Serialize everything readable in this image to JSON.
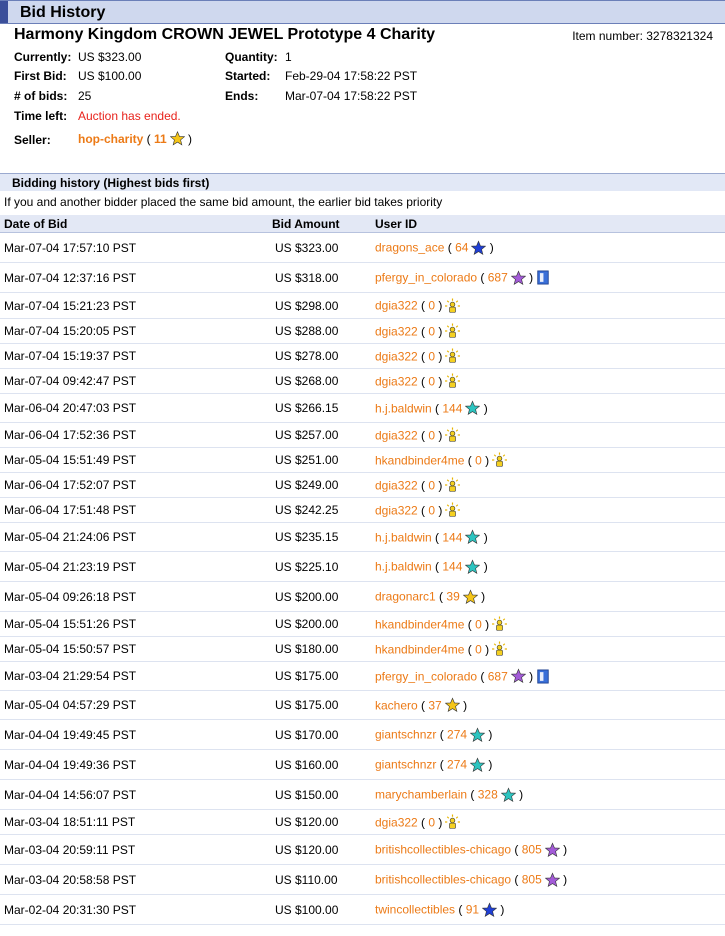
{
  "header": {
    "title": "Bid History"
  },
  "item": {
    "title": "Harmony Kingdom CROWN JEWEL Prototype 4 Charity",
    "number_label": "Item number:",
    "number": "3278321324"
  },
  "summary": {
    "currently_label": "Currently:",
    "currently": "US $323.00",
    "first_bid_label": "First Bid:",
    "first_bid": "US $100.00",
    "num_bids_label": "# of bids:",
    "num_bids": "25",
    "time_left_label": "Time left:",
    "time_left": "Auction has ended.",
    "quantity_label": "Quantity:",
    "quantity": "1",
    "started_label": "Started:",
    "started": "Feb-29-04 17:58:22 PST",
    "ends_label": "Ends:",
    "ends": "Mar-07-04 17:58:22 PST",
    "seller_label": "Seller:",
    "seller": "hop-charity",
    "seller_feedback": "11",
    "seller_star": "#f5c518"
  },
  "history": {
    "section_title": "Bidding history (Highest bids first)",
    "note": "If you and another bidder placed the same bid amount, the earlier bid takes priority",
    "columns": [
      "Date of Bid",
      "Bid Amount",
      "User ID"
    ],
    "rows": [
      {
        "date": "Mar-07-04 17:57:10 PST",
        "amount": "US $323.00",
        "user": "dragons_ace",
        "feedback": "64",
        "icon": "blue-star"
      },
      {
        "date": "Mar-07-04 12:37:16 PST",
        "amount": "US $318.00",
        "user": "pfergy_in_colorado",
        "feedback": "687",
        "icon": "purple-star",
        "me": true
      },
      {
        "date": "Mar-07-04 15:21:23 PST",
        "amount": "US $298.00",
        "user": "dgia322",
        "feedback": "0",
        "icon": "new-user"
      },
      {
        "date": "Mar-07-04 15:20:05 PST",
        "amount": "US $288.00",
        "user": "dgia322",
        "feedback": "0",
        "icon": "new-user"
      },
      {
        "date": "Mar-07-04 15:19:37 PST",
        "amount": "US $278.00",
        "user": "dgia322",
        "feedback": "0",
        "icon": "new-user"
      },
      {
        "date": "Mar-07-04 09:42:47 PST",
        "amount": "US $268.00",
        "user": "dgia322",
        "feedback": "0",
        "icon": "new-user"
      },
      {
        "date": "Mar-06-04 20:47:03 PST",
        "amount": "US $266.15",
        "user": "h.j.baldwin",
        "feedback": "144",
        "icon": "turquoise-star"
      },
      {
        "date": "Mar-06-04 17:52:36 PST",
        "amount": "US $257.00",
        "user": "dgia322",
        "feedback": "0",
        "icon": "new-user"
      },
      {
        "date": "Mar-05-04 15:51:49 PST",
        "amount": "US $251.00",
        "user": "hkandbinder4me",
        "feedback": "0",
        "icon": "new-user"
      },
      {
        "date": "Mar-06-04 17:52:07 PST",
        "amount": "US $249.00",
        "user": "dgia322",
        "feedback": "0",
        "icon": "new-user"
      },
      {
        "date": "Mar-06-04 17:51:48 PST",
        "amount": "US $242.25",
        "user": "dgia322",
        "feedback": "0",
        "icon": "new-user"
      },
      {
        "date": "Mar-05-04 21:24:06 PST",
        "amount": "US $235.15",
        "user": "h.j.baldwin",
        "feedback": "144",
        "icon": "turquoise-star"
      },
      {
        "date": "Mar-05-04 21:23:19 PST",
        "amount": "US $225.10",
        "user": "h.j.baldwin",
        "feedback": "144",
        "icon": "turquoise-star"
      },
      {
        "date": "Mar-05-04 09:26:18 PST",
        "amount": "US $200.00",
        "user": "dragonarc1",
        "feedback": "39",
        "icon": "yellow-star"
      },
      {
        "date": "Mar-05-04 15:51:26 PST",
        "amount": "US $200.00",
        "user": "hkandbinder4me",
        "feedback": "0",
        "icon": "new-user"
      },
      {
        "date": "Mar-05-04 15:50:57 PST",
        "amount": "US $180.00",
        "user": "hkandbinder4me",
        "feedback": "0",
        "icon": "new-user"
      },
      {
        "date": "Mar-03-04 21:29:54 PST",
        "amount": "US $175.00",
        "user": "pfergy_in_colorado",
        "feedback": "687",
        "icon": "purple-star",
        "me": true
      },
      {
        "date": "Mar-05-04 04:57:29 PST",
        "amount": "US $175.00",
        "user": "kachero",
        "feedback": "37",
        "icon": "yellow-star"
      },
      {
        "date": "Mar-04-04 19:49:45 PST",
        "amount": "US $170.00",
        "user": "giantschnzr",
        "feedback": "274",
        "icon": "turquoise-star"
      },
      {
        "date": "Mar-04-04 19:49:36 PST",
        "amount": "US $160.00",
        "user": "giantschnzr",
        "feedback": "274",
        "icon": "turquoise-star"
      },
      {
        "date": "Mar-04-04 14:56:07 PST",
        "amount": "US $150.00",
        "user": "marychamberlain",
        "feedback": "328",
        "icon": "turquoise-star"
      },
      {
        "date": "Mar-03-04 18:51:11 PST",
        "amount": "US $120.00",
        "user": "dgia322",
        "feedback": "0",
        "icon": "new-user"
      },
      {
        "date": "Mar-03-04 20:59:11 PST",
        "amount": "US $120.00",
        "user": "britishcollectibles-chicago",
        "feedback": "805",
        "icon": "purple-star"
      },
      {
        "date": "Mar-03-04 20:58:58 PST",
        "amount": "US $110.00",
        "user": "britishcollectibles-chicago",
        "feedback": "805",
        "icon": "purple-star"
      },
      {
        "date": "Mar-02-04 20:31:30 PST",
        "amount": "US $100.00",
        "user": "twincollectibles",
        "feedback": "91",
        "icon": "blue-star"
      }
    ]
  },
  "icon_colors": {
    "blue-star": "#1f3fd6",
    "purple-star": "#a35bd8",
    "turquoise-star": "#2cc4c0",
    "yellow-star": "#f5c518"
  }
}
